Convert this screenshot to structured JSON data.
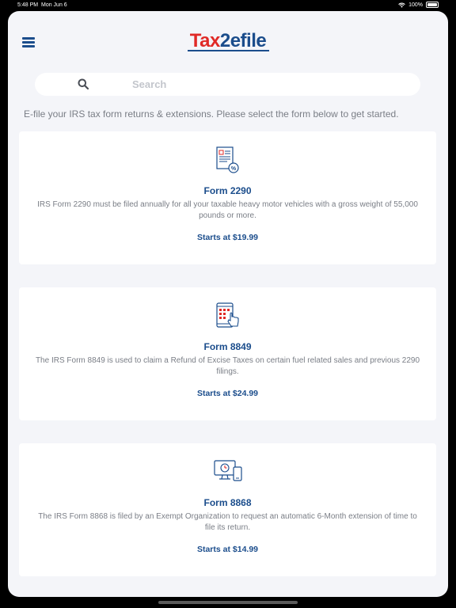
{
  "status": {
    "time": "5:48 PM",
    "date": "Mon Jun 6",
    "battery": "100%"
  },
  "header": {
    "logo_part1": "Tax",
    "logo_part2": "2efile"
  },
  "search": {
    "placeholder": "Search"
  },
  "intro": "E-file your IRS tax form returns & extensions. Please select the form below to get started.",
  "forms": [
    {
      "title": "Form 2290",
      "description": "IRS Form 2290 must be filed annually for all your taxable heavy motor vehicles with a gross weight of 55,000 pounds or more.",
      "price": "Starts at $19.99",
      "icon": "tax-document-icon"
    },
    {
      "title": "Form 8849",
      "description": "The IRS Form 8849 is used to claim a Refund of Excise Taxes on certain fuel related sales and previous 2290 filings.",
      "price": "Starts at $24.99",
      "icon": "tablet-tap-icon"
    },
    {
      "title": "Form 8868",
      "description": "The IRS Form 8868 is filed by an Exempt Organization to request an automatic 6-Month extension of time to file its return.",
      "price": "Starts at $14.99",
      "icon": "devices-clock-icon"
    }
  ],
  "colors": {
    "brand_blue": "#1b4d8c",
    "brand_red": "#e02a27",
    "background": "#f4f5f9"
  }
}
